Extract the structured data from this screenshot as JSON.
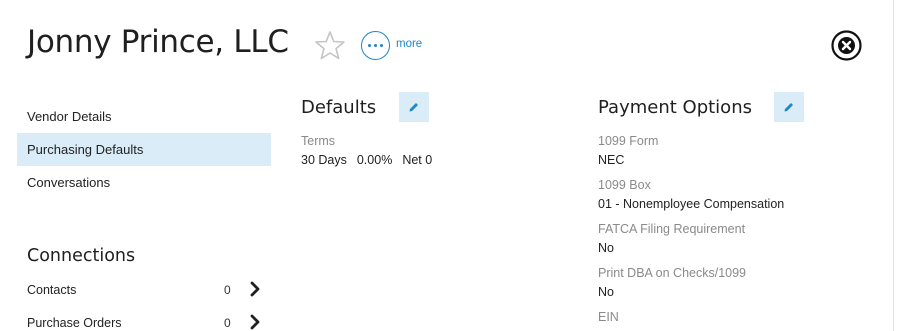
{
  "header": {
    "title": "Jonny Prince, LLC",
    "more_label": "more"
  },
  "nav": {
    "items": [
      {
        "label": "Vendor Details",
        "active": false
      },
      {
        "label": "Purchasing Defaults",
        "active": true
      },
      {
        "label": "Conversations",
        "active": false
      }
    ]
  },
  "connections": {
    "title": "Connections",
    "rows": [
      {
        "label": "Contacts",
        "count": "0"
      },
      {
        "label": "Purchase Orders",
        "count": "0"
      }
    ]
  },
  "defaults": {
    "title": "Defaults",
    "terms_label": "Terms",
    "terms_days": "30 Days",
    "terms_discount": "0.00%",
    "terms_net": "Net 0"
  },
  "payment": {
    "title": "Payment Options",
    "fields": [
      {
        "label": "1099 Form",
        "value": "NEC"
      },
      {
        "label": "1099 Box",
        "value": "01 - Nonemployee Compensation"
      },
      {
        "label": "FATCA Filing Requirement",
        "value": "No"
      },
      {
        "label": "Print DBA on Checks/1099",
        "value": "No"
      },
      {
        "label": "EIN",
        "value": ""
      }
    ]
  },
  "colors": {
    "accent": "#1f86c8",
    "active_bg": "#d9ecf8",
    "label_gray": "#8a8a8a"
  },
  "icons": [
    "star-outline-icon",
    "more-dots-icon",
    "close-circle-icon",
    "chevron-right-icon",
    "pencil-icon"
  ]
}
